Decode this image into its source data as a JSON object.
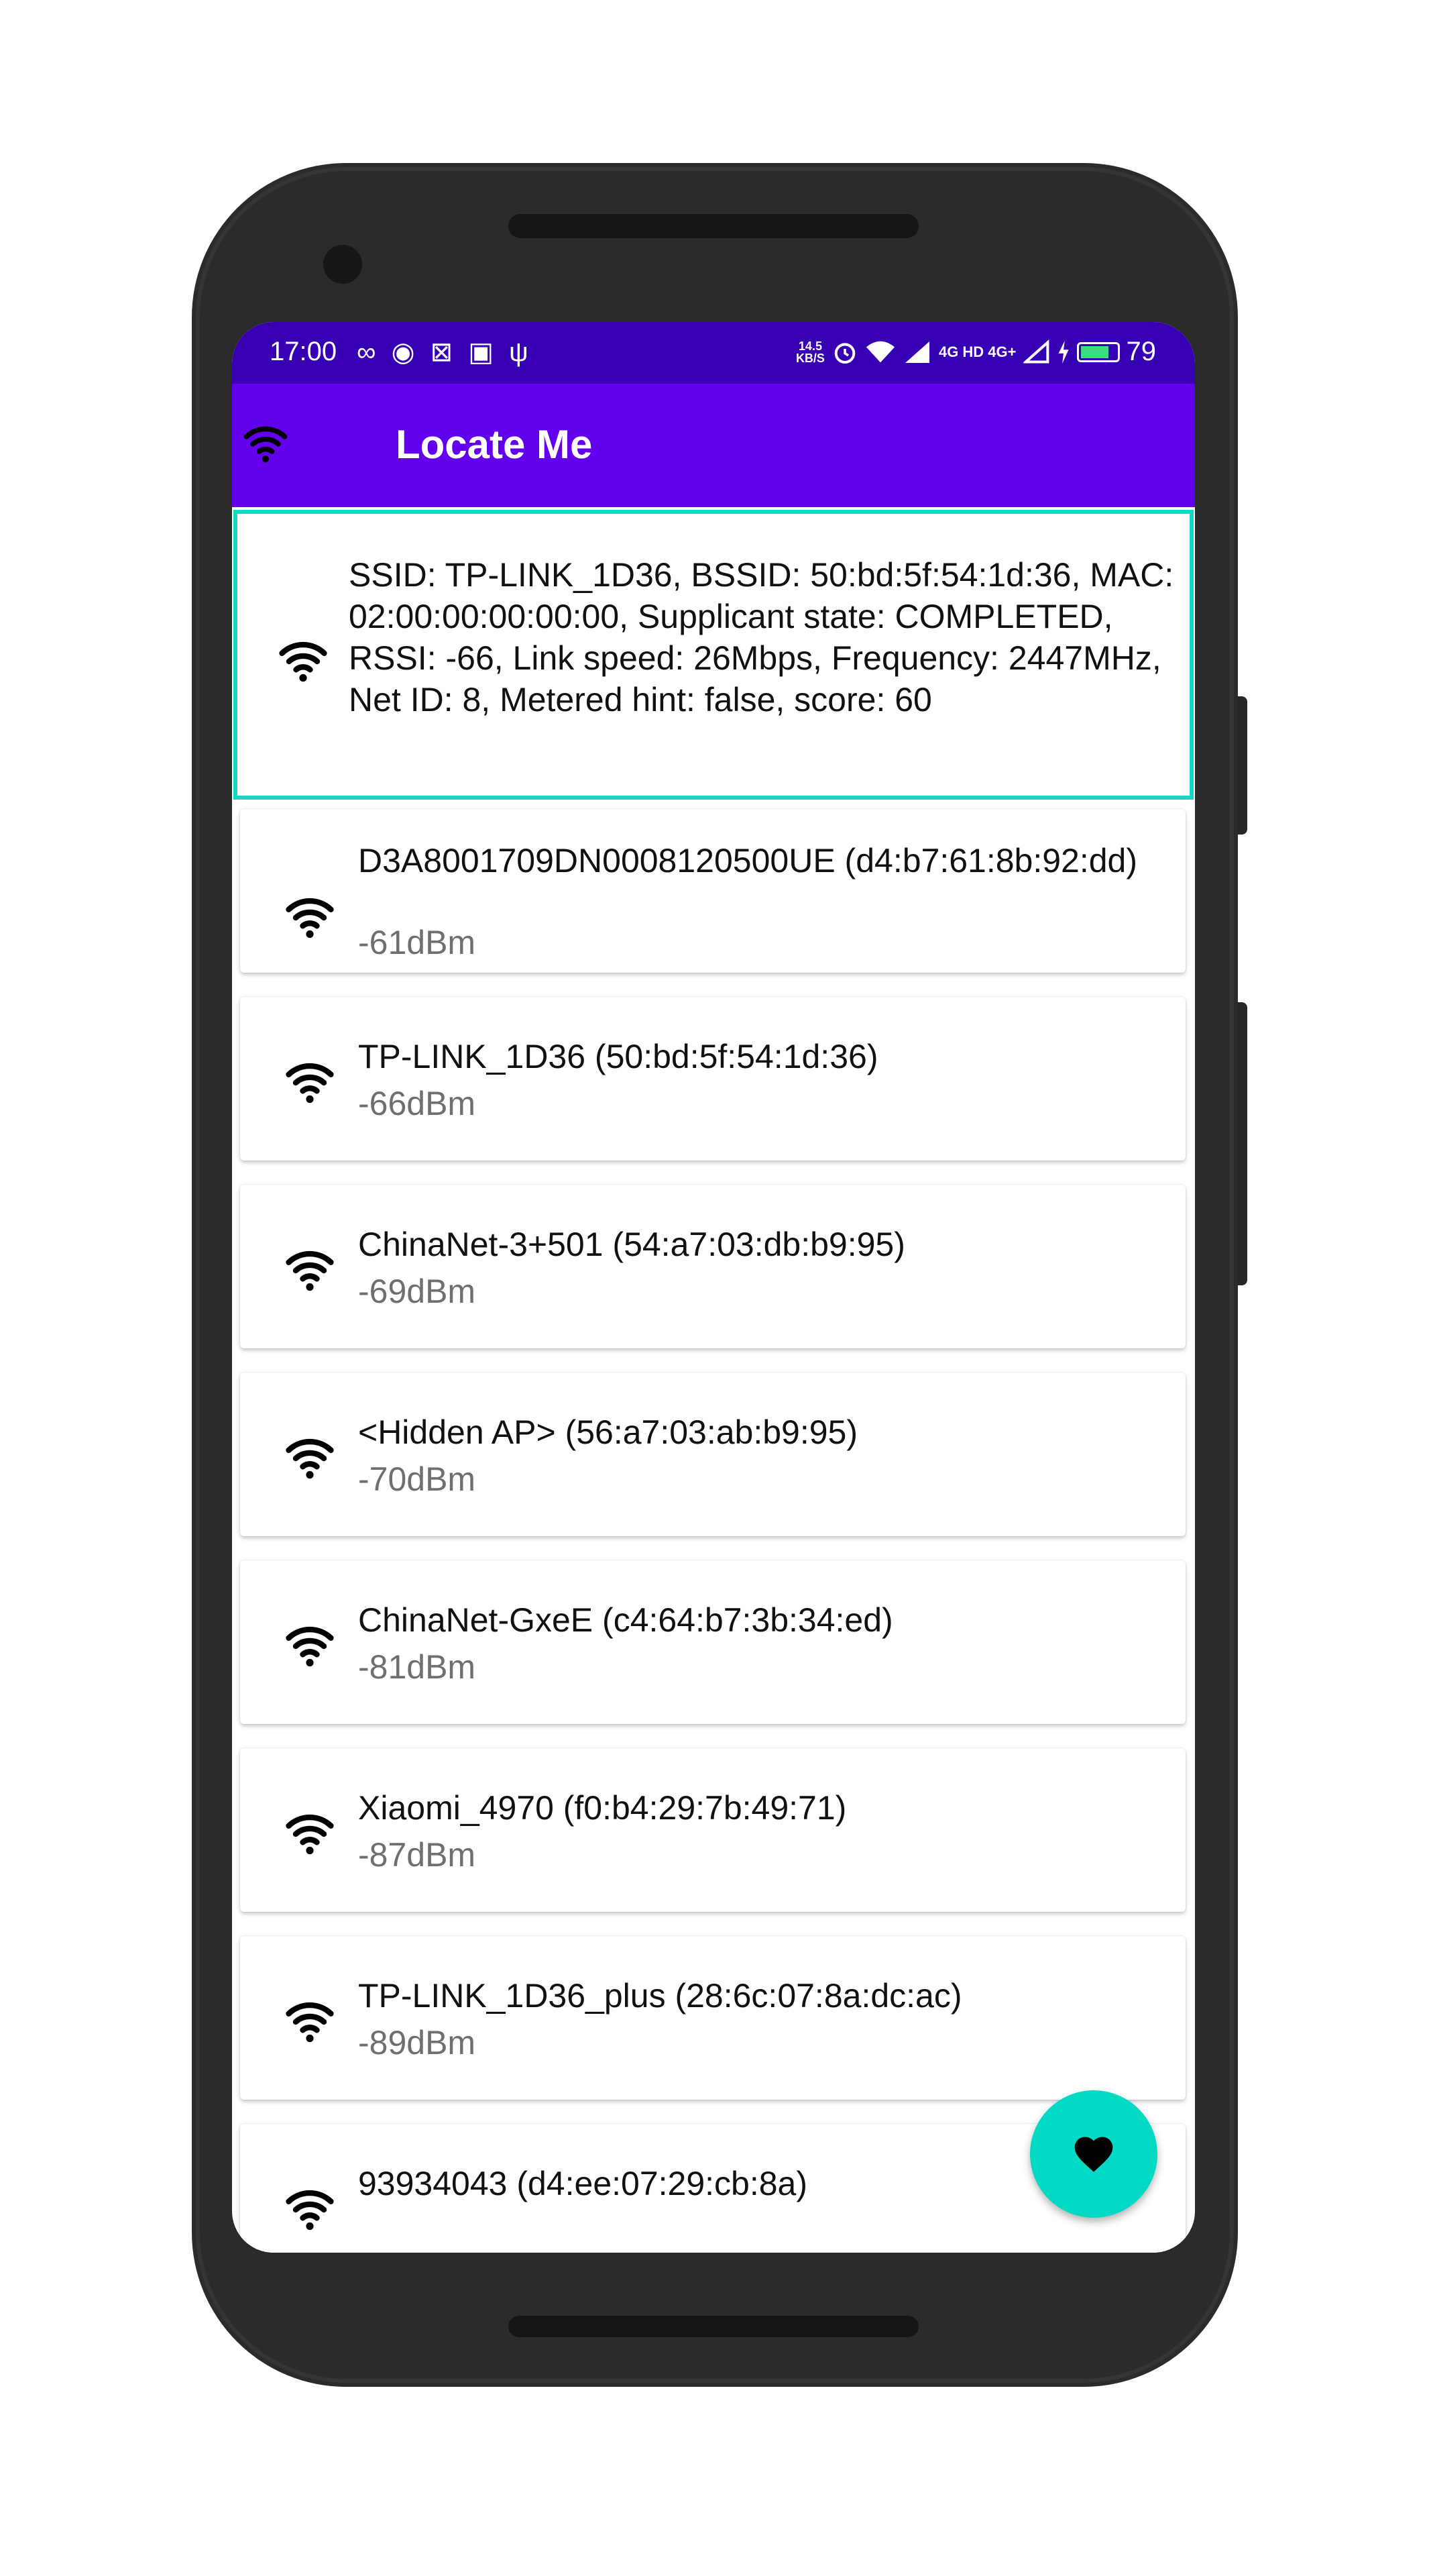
{
  "status_bar": {
    "time": "17:00",
    "left_icons": "∞ ◉ ⊠ ▣ ψ",
    "net_speed_value": "14.5",
    "net_speed_unit": "KB/S",
    "network_labels": "4G HD 4G+",
    "battery_percent": "79",
    "battery_level": 0.79
  },
  "app_bar": {
    "title": "Locate Me",
    "icon": "wifi-icon",
    "background_color": "#6200ee"
  },
  "connection_info": {
    "text": "SSID: TP-LINK_1D36, BSSID: 50:bd:5f:54:1d:36, MAC: 02:00:00:00:00:00, Supplicant state: COMPLETED, RSSI: -66, Link speed: 26Mbps, Frequency: 2447MHz, Net ID: 8, Metered hint: false, score: 60",
    "border_color": "#16d6c4"
  },
  "access_points": [
    {
      "name": "D3A8001709DN0008120500UE (d4:b7:61:8b:92:dd)",
      "level": "-61dBm"
    },
    {
      "name": "TP-LINK_1D36 (50:bd:5f:54:1d:36)",
      "level": "-66dBm"
    },
    {
      "name": "ChinaNet-3+501 (54:a7:03:db:b9:95)",
      "level": "-69dBm"
    },
    {
      "name": "<Hidden AP> (56:a7:03:ab:b9:95)",
      "level": "-70dBm"
    },
    {
      "name": "ChinaNet-GxeE (c4:64:b7:3b:34:ed)",
      "level": "-81dBm"
    },
    {
      "name": "Xiaomi_4970 (f0:b4:29:7b:49:71)",
      "level": "-87dBm"
    },
    {
      "name": "TP-LINK_1D36_plus (28:6c:07:8a:dc:ac)",
      "level": "-89dBm"
    },
    {
      "name": "93934043 (d4:ee:07:29:cb:8a)",
      "level": ""
    }
  ],
  "fab": {
    "icon": "heart-icon",
    "color": "#03dac5"
  }
}
